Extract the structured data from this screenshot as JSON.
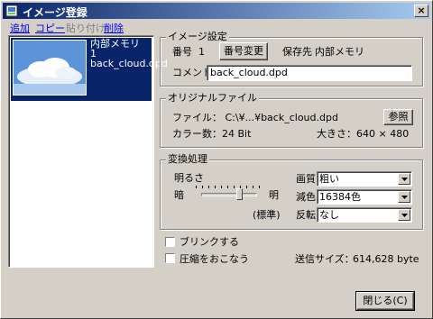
{
  "window": {
    "title": "イメージ登録",
    "close_glyph": "×"
  },
  "menu": {
    "add": "追加",
    "copy": "コピー",
    "paste": "貼り付け",
    "delete": "削除"
  },
  "list": {
    "items": [
      {
        "storage": "内部メモリ",
        "number": "1",
        "filename": "back_cloud.dpd",
        "selected": true
      }
    ]
  },
  "image_settings": {
    "group_label": "イメージ設定",
    "number_label": "番号",
    "number_value": "1",
    "change_number_button": "番号変更",
    "storage_label": "保存先",
    "storage_value": "内部メモリ",
    "comment_label": "コメント",
    "comment_value": "back_cloud.dpd"
  },
  "original_file": {
    "group_label": "オリジナルファイル",
    "file_text": "ファイル： C:\\¥...¥back_cloud.dpd",
    "browse_button": "参照",
    "colors_text": "カラー数：24 Bit",
    "size_text": "大きさ：640 × 480"
  },
  "conversion": {
    "group_label": "変換処理",
    "brightness_label": "明るさ",
    "dark_label": "暗",
    "bright_label": "明",
    "standard_label": "(標準)",
    "quality_label": "画質",
    "quality_value": "粗い",
    "colors_label": "減色",
    "colors_value": "16384色",
    "invert_label": "反転",
    "invert_value": "なし",
    "brightness_level_fraction": 0.68
  },
  "options": {
    "blink_label": "ブリンクする",
    "blink_checked": false,
    "compress_label": "圧縮をおこなう",
    "compress_checked": false,
    "send_size_label": "送信サイズ：",
    "send_size_value": "614,628 byte"
  },
  "footer": {
    "close_button": "閉じる(C)"
  },
  "colors": {
    "titlebar_start": "#0a246a",
    "titlebar_end": "#a6caf0",
    "selection": "#0a246a",
    "face": "#d4d0c8",
    "link": "#0000ee"
  }
}
